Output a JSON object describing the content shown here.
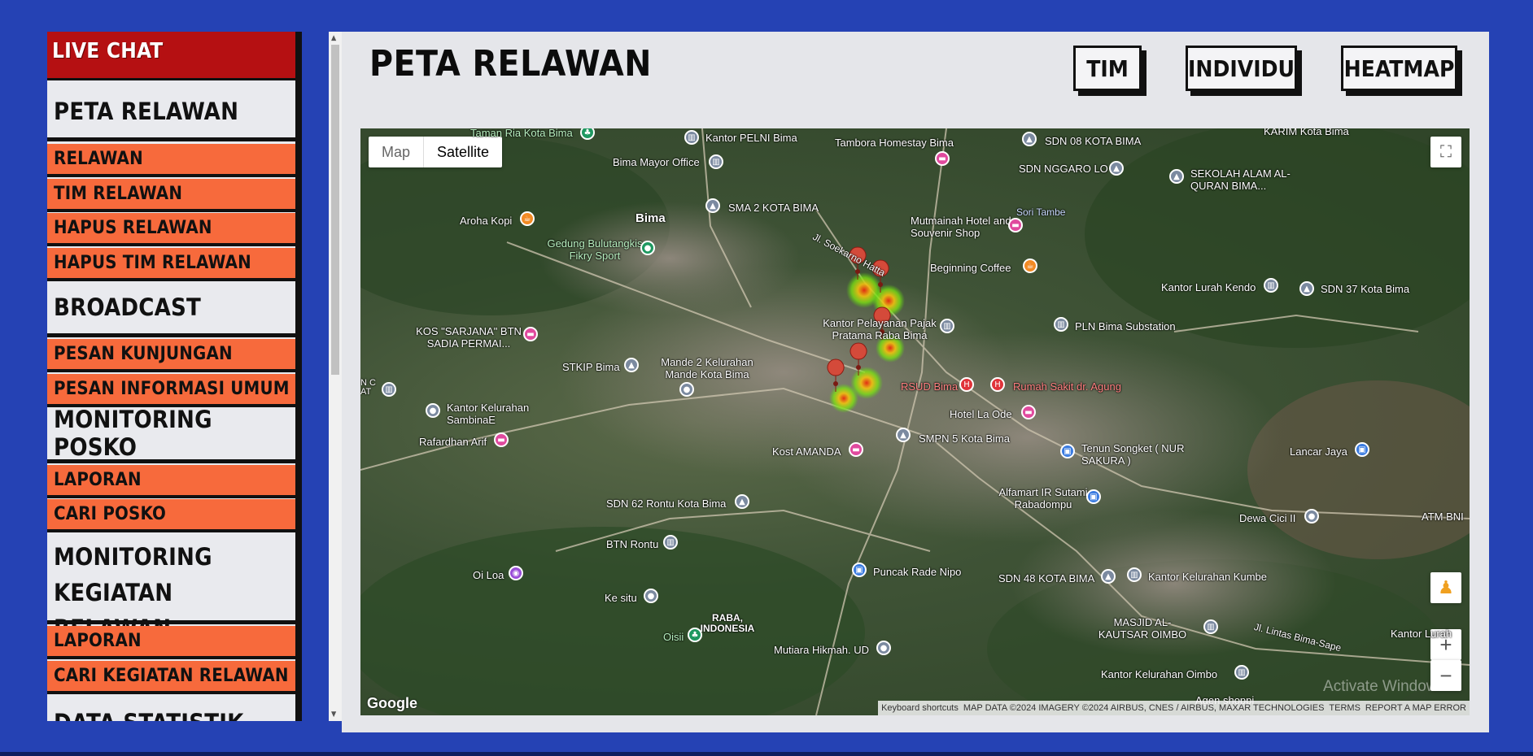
{
  "sidebar": {
    "live_chat": "LIVE CHAT",
    "peta_relawan": "PETA RELAWAN",
    "relawan": "RELAWAN",
    "tim_relawan": "TIM RELAWAN",
    "hapus_relawan": "HAPUS RELAWAN",
    "hapus_tim_relawan": "HAPUS TIM RELAWAN",
    "broadcast": "BROADCAST",
    "pesan_kunjungan": "PESAN KUNJUNGAN",
    "pesan_informasi_umum": "PESAN INFORMASI UMUM",
    "monitoring_posko": "MONITORING POSKO",
    "laporan_posko": "LAPORAN",
    "cari_posko": "CARI POSKO",
    "monitoring_kegiatan": "MONITORING KEGIATAN",
    "monitoring_kegiatan_2": "RELAWAN",
    "laporan_kegiatan": "LAPORAN",
    "cari_kegiatan": "CARI KEGIATAN RELAWAN",
    "data_statistik": "DATA STATISTIK"
  },
  "header": {
    "title": "PETA RELAWAN",
    "btn_tim": "TIM",
    "btn_individu": "INDIVIDU",
    "btn_heatmap": "HEATMAP"
  },
  "map": {
    "type_map": "Map",
    "type_satellite": "Satellite",
    "google": "Google",
    "attribution": {
      "shortcuts": "Keyboard shortcuts",
      "data": "MAP DATA ©2024 IMAGERY ©2024 AIRBUS, CNES / AIRBUS, MAXAR TECHNOLOGIES",
      "terms": "TERMS",
      "report": "REPORT A MAP ERROR"
    },
    "watermark": "Activate Windows",
    "labels": {
      "l1": "Taman Ria Kota Bima",
      "l2": "Kantor PELNI Bima",
      "l3": "Tambora Homestay Bima",
      "l4": "SDN 08 KOTA BIMA",
      "l5": "KARIM Kota Bima",
      "l6": "Bima Mayor Office",
      "l7": "SDN NGGARO LO",
      "l8": "SEKOLAH ALAM AL-QURAN BIMA...",
      "l9": "Bima",
      "l10": "SMA 2 KOTA BIMA",
      "l11": "Aroha Kopi",
      "l12": "Mutmainah Hotel and Souvenir Shop",
      "l13": "Sori Tambe",
      "l14": "Gedung Bulutangkis Fikry Sport",
      "l15": "Jl. Soekarno Hatta",
      "l16": "Beginning Coffee",
      "l17": "Kantor Lurah Kendo",
      "l18": "SDN 37 Kota Bima",
      "l19": "Kantor Pelayanan Pajak Pratama Raba Bima",
      "l20": "PLN Bima Substation",
      "l21": "KOS \"SARJANA\" BTN SADIA PERMAI...",
      "l22": "STKIP Bima",
      "l23": "Mande 2 Kelurahan Mande Kota Bima",
      "l24": "RSUD Bima",
      "l25": "Rumah Sakit dr. Agung",
      "l26": "Kantor Kelurahan SambinaE",
      "l27": "Hotel La Ode",
      "l28": "Rafardhan Arif",
      "l29": "SMPN 5 Kota Bima",
      "l30": "Tenun Songket ( NUR SAKURA )",
      "l31": "Kost AMANDA",
      "l32": "Lancar Jaya",
      "l33": "Alfamart IR Sutami Rabadompu",
      "l34": "SDN 62 Rontu Kota Bima",
      "l35": "Dewa Cici II",
      "l36": "ATM BNI",
      "l37": "BTN Rontu",
      "l38": "Oi Loa",
      "l39": "Puncak Rade Nipo",
      "l40": "SDN 48 KOTA BIMA",
      "l41": "Kantor Kelurahan Kumbe",
      "l42": "Ke situ",
      "l43": "RABA, INDONESIA",
      "l44": "MASJID AL-KAUTSAR OIMBO",
      "l45": "Jl. Lintas Bima-Sape",
      "l46": "Kantor Lurah",
      "l47": "Oisii",
      "l48": "Mutiara Hikmah. UD",
      "l49": "Kantor Kelurahan Oimbo",
      "l50": "Agen shoppi",
      "l51": "N C AT"
    }
  },
  "colors": {
    "background": "#2542b4",
    "live_chat": "#b51012",
    "sub_item": "#f76a3c",
    "panel": "#e5e6ea"
  }
}
